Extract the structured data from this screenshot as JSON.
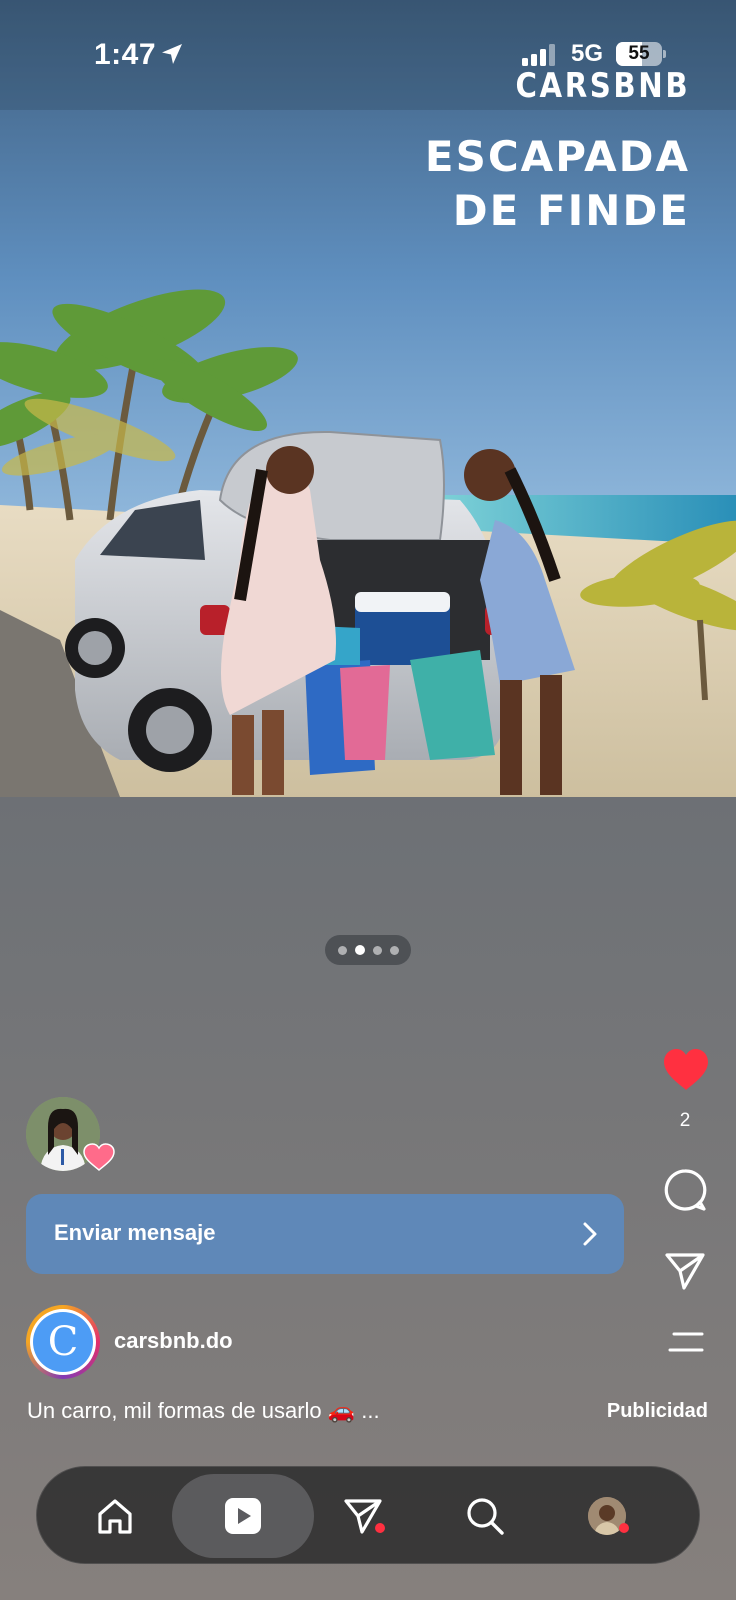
{
  "status_bar": {
    "time": "1:47",
    "network": "5G",
    "battery": "55"
  },
  "ad": {
    "brand": "CARSBNB",
    "headline_line1": "ESCAPADA",
    "headline_line2": "DE FINDE"
  },
  "carousel": {
    "count": 4,
    "active_index": 1
  },
  "actions": {
    "like_count": "2"
  },
  "cta": {
    "label": "Enviar mensaje"
  },
  "account": {
    "name": "carsbnb.do",
    "logo_letter": "C"
  },
  "caption": {
    "text": "Un carro, mil formas de usarlo 🚗 ...",
    "sponsored": "Publicidad"
  },
  "nav": {
    "items": [
      "home-icon",
      "reels-icon",
      "direct-icon",
      "search-icon",
      "profile-avatar"
    ]
  },
  "colors": {
    "like": "#ff3040",
    "cta": "#5f88b8",
    "brand_blue": "#4d9cf5"
  }
}
